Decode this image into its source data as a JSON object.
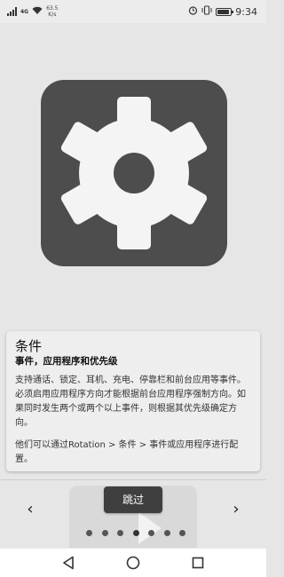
{
  "status_bar": {
    "net_speed_value": "63.5",
    "net_speed_unit": "K/s",
    "network_tag": "4G",
    "time": "9:34",
    "battery_level": 0.9
  },
  "card": {
    "title": "条件",
    "subtitle": "事件，应用程序和优先级",
    "body": "支持通话、锁定、耳机、充电、停靠栏和前台应用等事件。必须启用应用程序方向才能根据前台应用程序强制方向。如果同时发生两个或两个以上事件，则根据其优先级确定方向。",
    "body2": "他们可以通过Rotation > 条件 > 事件或应用程序进行配置。"
  },
  "navigation": {
    "prev_label": "‹",
    "next_label": "›",
    "skip_label": "跳过",
    "page_count": 7,
    "current_page": 4
  },
  "icons": {
    "hero": "gear-icon",
    "back": "back-triangle-icon",
    "home": "home-circle-icon",
    "recents": "recents-square-icon"
  },
  "colors": {
    "hero_bg": "#4d4d4d",
    "skip_button_bg": "#3f3f3f",
    "background": "#e6e6e6"
  }
}
